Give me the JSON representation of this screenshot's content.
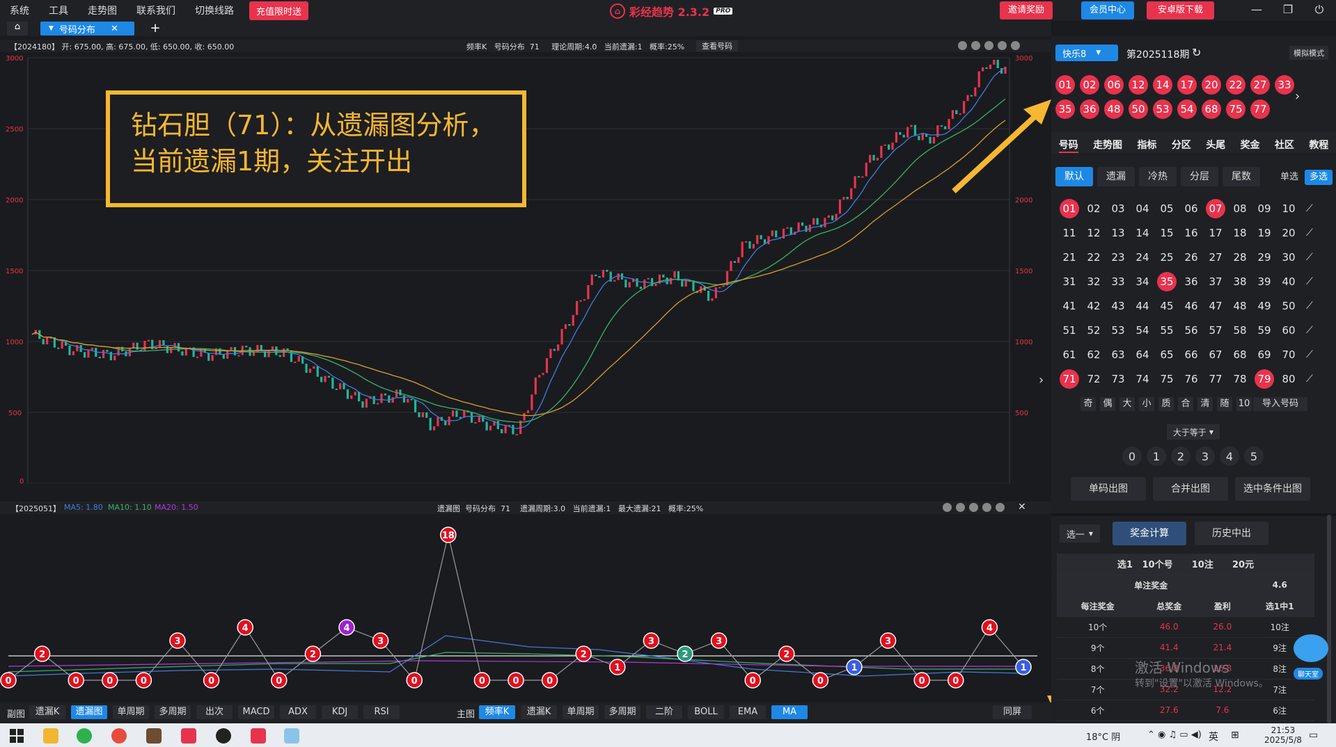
{
  "menu": [
    "系统",
    "工具",
    "走势图",
    "联系我们",
    "切换线路"
  ],
  "promo": "充值限时送",
  "app_title": "彩经趋势 2.3.2",
  "pro_badge": "PRO",
  "top_buttons": {
    "invite": "邀请奖励",
    "member": "会员中心",
    "android": "安卓版下载"
  },
  "tab": {
    "label": "号码分布",
    "close": "✕",
    "add": "+"
  },
  "main_chart": {
    "info": "【2024180】 开: 675.00, 高: 675.00, 低: 650.00, 收: 650.00",
    "mid": "频率K   号码分布  71     理论周期:4.0   当前遗漏:1   概率:25%",
    "view_btn": "查看号码",
    "y_ticks": [
      "3000",
      "2500",
      "2000",
      "1500",
      "1000",
      "500",
      "0"
    ]
  },
  "annotation": {
    "line1": "钻石胆（71）：从遗漏图分析，",
    "line2": "当前遗漏1期，关注开出"
  },
  "sub_chart": {
    "info_id": "【2025051】",
    "ma5": "MA5: 1.80",
    "ma10": "MA10: 1.10",
    "ma20": "MA20: 1.50",
    "mid": "遗漏图  号码分布  71    遗漏周期:3.0   当前遗漏:1   最大遗漏:21   概率:25%"
  },
  "chart_data": {
    "type": "line",
    "title": "遗漏图",
    "series": [
      {
        "name": "遗漏",
        "values": [
          0,
          2,
          0,
          0,
          0,
          3,
          0,
          4,
          0,
          2,
          4,
          3,
          0,
          18,
          0,
          0,
          0,
          2,
          1,
          3,
          2,
          3,
          0,
          2,
          0,
          1,
          3,
          0,
          0,
          4,
          1
        ]
      }
    ]
  },
  "bottom_left": {
    "label": "副图",
    "buttons": [
      "遗漏K",
      "遗漏图",
      "单周期",
      "多周期",
      "出次",
      "MACD",
      "ADX",
      "KDJ",
      "RSI"
    ],
    "active": "遗漏图"
  },
  "bottom_right": {
    "label": "主图",
    "buttons": [
      "频率K",
      "遗漏K",
      "单周期",
      "多周期",
      "二阶",
      "BOLL",
      "EMA",
      "MA"
    ],
    "active": [
      "频率K",
      "MA"
    ],
    "sync": "同屏"
  },
  "right": {
    "lottery": "快乐8",
    "period": "第2025118期",
    "mode": "模拟模式",
    "draw_numbers": [
      "01",
      "02",
      "06",
      "12",
      "14",
      "17",
      "20",
      "22",
      "27",
      "33",
      "35",
      "36",
      "48",
      "50",
      "53",
      "54",
      "68",
      "75",
      "77"
    ],
    "tabs": [
      "号码",
      "走势图",
      "指标",
      "分区",
      "头尾",
      "奖金",
      "社区",
      "教程"
    ],
    "filters": [
      "默认",
      "遗漏",
      "冷热",
      "分层",
      "尾数"
    ],
    "single": "单选",
    "multi": "多选",
    "hits": [
      "01",
      "07",
      "35",
      "71",
      "79"
    ],
    "quick": [
      "奇",
      "偶",
      "大",
      "小",
      "质",
      "合",
      "清",
      "随",
      "10"
    ],
    "import": "导入号码",
    "ge_select": "大于等于",
    "counts": [
      "0",
      "1",
      "2",
      "3",
      "4",
      "5"
    ],
    "actions": [
      "单码出图",
      "合并出图",
      "选中条件出图"
    ],
    "select": "选一",
    "calc": "奖金计算",
    "history": "历史中出",
    "table_head": [
      "选1",
      "10个号",
      "10注",
      "20元"
    ],
    "single_prize_label": "单注奖金",
    "single_prize": "4.6",
    "cols": [
      "每注奖金",
      "总奖金",
      "盈利",
      "选1中1"
    ],
    "rows": [
      [
        "10个",
        "46.0",
        "26.0",
        "10注"
      ],
      [
        "9个",
        "41.4",
        "21.4",
        "9注"
      ],
      [
        "8个",
        "36.8",
        "16.8",
        "8注"
      ],
      [
        "7个",
        "32.2",
        "12.2",
        "7注"
      ],
      [
        "6个",
        "27.6",
        "7.6",
        "6注"
      ]
    ],
    "chat": "聊天室"
  },
  "watermark": {
    "line1": "激活 Windows",
    "line2": "转到\"设置\"以激活 Windows。"
  },
  "taskbar": {
    "weather": "18°C 阴",
    "lang": "英",
    "time": "21:53",
    "date": "2025/5/8"
  }
}
